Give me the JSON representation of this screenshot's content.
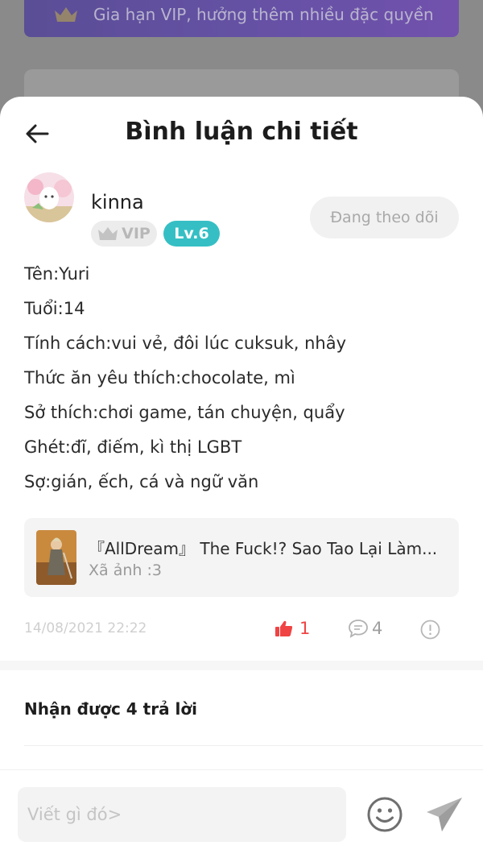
{
  "background": {
    "vip_banner_text": "Gia hạn VIP, hưởng thêm nhiều đặc quyền"
  },
  "header": {
    "title": "Bình luận chi tiết",
    "back_icon": "arrow-left-icon"
  },
  "user": {
    "name": "kinna",
    "vip_badge": "VIP",
    "level_badge": "Lv.6",
    "follow_label": "Đang theo dõi"
  },
  "post": {
    "lines": [
      "Tên:Yuri",
      "Tuổi:14",
      "Tính cách:vui vẻ, đôi lúc cuksuk, nhây",
      "Thức ăn yêu thích:chocolate, mì",
      "Sở thích:chơi game, tán chuyện, quẩy",
      "Ghét:đĩ, điếm, kì thị LGBT",
      "Sợ:gián, ếch, cá và ngữ văn"
    ]
  },
  "linked": {
    "title": "『AllDream』 The Fuck!? Sao Tao Lại Làm...",
    "subtitle": "Xã ảnh :3"
  },
  "meta": {
    "date": "14/08/2021 22:22",
    "likes": "1",
    "comments": "4"
  },
  "replies": {
    "heading": "Nhận được 4 trả lời"
  },
  "composer": {
    "placeholder": "Viết gì đó>"
  },
  "colors": {
    "accent_level": "#35bfc4",
    "like_red": "#f04343",
    "vip_purple": "#5b3fb0"
  }
}
